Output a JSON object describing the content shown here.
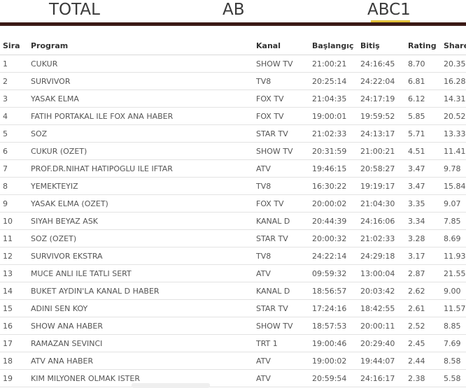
{
  "tabs": [
    {
      "label": "TOTAL"
    },
    {
      "label": "AB"
    },
    {
      "label": "ABC1"
    }
  ],
  "table": {
    "headers": {
      "sira": "Sira",
      "program": "Program",
      "kanal": "Kanal",
      "baslangic": "Başlangıç",
      "bitis": "Bitiş",
      "rating": "Rating",
      "share": "Share"
    },
    "rows": [
      [
        "1",
        "CUKUR",
        "SHOW TV",
        "21:00:21",
        "24:16:45",
        "8.70",
        "20.35"
      ],
      [
        "2",
        "SURVIVOR",
        "TV8",
        "20:25:14",
        "24:22:04",
        "6.81",
        "16.28"
      ],
      [
        "3",
        "YASAK ELMA",
        "FOX TV",
        "21:04:35",
        "24:17:19",
        "6.12",
        "14.31"
      ],
      [
        "4",
        "FATIH PORTAKAL ILE FOX ANA HABER",
        "FOX TV",
        "19:00:01",
        "19:59:52",
        "5.85",
        "20.52"
      ],
      [
        "5",
        "SOZ",
        "STAR TV",
        "21:02:33",
        "24:13:17",
        "5.71",
        "13.33"
      ],
      [
        "6",
        "CUKUR (OZET)",
        "SHOW TV",
        "20:31:59",
        "21:00:21",
        "4.51",
        "11.41"
      ],
      [
        "7",
        "PROF.DR.NIHAT HATIPOGLU ILE IFTAR",
        "ATV",
        "19:46:15",
        "20:58:27",
        "3.47",
        "9.78"
      ],
      [
        "8",
        "YEMEKTEYIZ",
        "TV8",
        "16:30:22",
        "19:19:17",
        "3.47",
        "15.84"
      ],
      [
        "9",
        "YASAK ELMA (OZET)",
        "FOX TV",
        "20:00:02",
        "21:04:30",
        "3.35",
        "9.07"
      ],
      [
        "10",
        "SIYAH BEYAZ ASK",
        "KANAL D",
        "20:44:39",
        "24:16:06",
        "3.34",
        "7.85"
      ],
      [
        "11",
        "SOZ (OZET)",
        "STAR TV",
        "20:00:32",
        "21:02:33",
        "3.28",
        "8.69"
      ],
      [
        "12",
        "SURVIVOR EKSTRA",
        "TV8",
        "24:22:14",
        "24:29:18",
        "3.17",
        "11.93"
      ],
      [
        "13",
        "MUCE ANLI ILE TATLI SERT",
        "ATV",
        "09:59:32",
        "13:00:04",
        "2.87",
        "21.55"
      ],
      [
        "14",
        "BUKET AYDIN'LA KANAL D HABER",
        "KANAL D",
        "18:56:57",
        "20:03:42",
        "2.62",
        "9.00"
      ],
      [
        "15",
        "ADINI SEN KOY",
        "STAR TV",
        "17:24:16",
        "18:42:55",
        "2.61",
        "11.57"
      ],
      [
        "16",
        "SHOW ANA HABER",
        "SHOW TV",
        "18:57:53",
        "20:00:11",
        "2.52",
        "8.85"
      ],
      [
        "17",
        "RAMAZAN SEVINCI",
        "TRT 1",
        "19:00:46",
        "20:29:40",
        "2.45",
        "7.69"
      ],
      [
        "18",
        "ATV ANA HABER",
        "ATV",
        "19:00:02",
        "19:44:07",
        "2.44",
        "8.58"
      ],
      [
        "19",
        "KIM MILYONER OLMAK ISTER",
        "ATV",
        "20:59:54",
        "24:16:17",
        "2.38",
        "5.58"
      ]
    ]
  }
}
